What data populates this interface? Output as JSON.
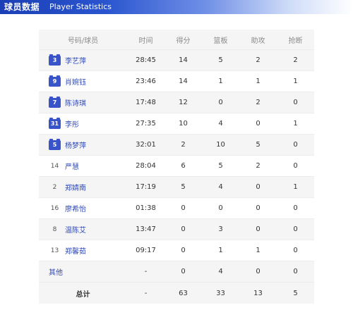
{
  "header": {
    "title": "球员数据",
    "subtitle": "Player Statistics"
  },
  "columns": [
    "号码/球员",
    "时间",
    "得分",
    "篮板",
    "助攻",
    "抢断"
  ],
  "players": [
    {
      "number": "3",
      "name": "李艺萍",
      "time": "28:45",
      "points": "14",
      "rebounds": "5",
      "assists": "2",
      "steals": "2"
    },
    {
      "number": "9",
      "name": "肖婉钰",
      "time": "23:46",
      "points": "14",
      "rebounds": "1",
      "assists": "1",
      "steals": "1"
    },
    {
      "number": "7",
      "name": "陈诗琪",
      "time": "17:48",
      "points": "12",
      "rebounds": "0",
      "assists": "2",
      "steals": "0"
    },
    {
      "number": "31",
      "name": "李彤",
      "time": "27:35",
      "points": "10",
      "rebounds": "4",
      "assists": "0",
      "steals": "1"
    },
    {
      "number": "5",
      "name": "杨梦萍",
      "time": "32:01",
      "points": "2",
      "rebounds": "10",
      "assists": "5",
      "steals": "0"
    },
    {
      "number": "14",
      "name": "严慧",
      "time": "28:04",
      "points": "6",
      "rebounds": "5",
      "assists": "2",
      "steals": "0"
    },
    {
      "number": "2",
      "name": "郑婧南",
      "time": "17:19",
      "points": "5",
      "rebounds": "4",
      "assists": "0",
      "steals": "1"
    },
    {
      "number": "16",
      "name": "廖希怡",
      "time": "01:38",
      "points": "0",
      "rebounds": "0",
      "assists": "0",
      "steals": "0"
    },
    {
      "number": "8",
      "name": "温陈艾",
      "time": "13:47",
      "points": "0",
      "rebounds": "3",
      "assists": "0",
      "steals": "0"
    },
    {
      "number": "13",
      "name": "郑馨茹",
      "time": "09:17",
      "points": "0",
      "rebounds": "1",
      "assists": "1",
      "steals": "0"
    }
  ],
  "others": {
    "label": "其他",
    "time": "-",
    "points": "0",
    "rebounds": "4",
    "assists": "0",
    "steals": "0"
  },
  "totals": {
    "label": "总计",
    "time": "-",
    "points": "63",
    "rebounds": "33",
    "assists": "13",
    "steals": "5"
  },
  "colors": {
    "header_bar": "#1b3fb6",
    "jersey": "#3953c8",
    "name_link": "#2f49b8",
    "row_alt": "#f5f5f5"
  }
}
